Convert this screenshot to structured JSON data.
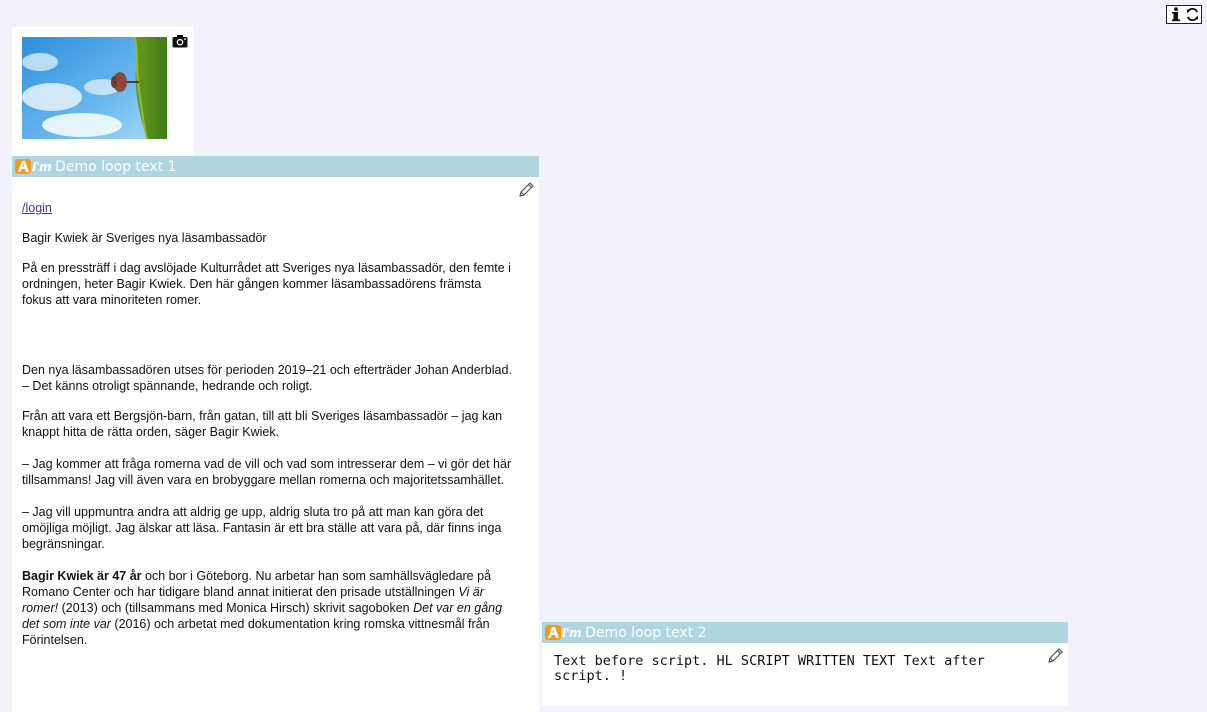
{
  "icons": {
    "info": "info-icon",
    "refresh": "refresh-icon",
    "camera": "camera-icon",
    "edit": "pencil-icon",
    "logo": "aim-logo-icon"
  },
  "colors": {
    "page_bg": "#f2f2fa",
    "panel_header": "#afd5e0",
    "link": "#5a2a8a",
    "logo_orange": "#f29a1a"
  },
  "logo": {
    "text": "I'm"
  },
  "panel1": {
    "title": "Demo loop text 1",
    "link": "/login",
    "headline": "Bagir Kwiek är Sveriges nya läsambassadör",
    "intro": "På en pressträff i dag avslöjade Kulturrådet att Sveriges nya läsambassadör, den femte i ordningen, heter Bagir Kwiek. Den här gången kommer läsambassadörens främsta fokus att vara minoriteten romer.",
    "para1_a": "Den nya läsambassadören utses för perioden 2019–21 och efterträder Johan Anderblad.",
    "para1_b": "– Det känns otroligt spännande, hedrande och roligt.",
    "para2": "Från att vara ett Bergsjön-barn, från gatan, till att bli Sveriges läsambassadör – jag kan knappt hitta de rätta orden, säger Bagir Kwiek.",
    "para3": "– Jag kommer att fråga romerna vad de vill och vad som intresserar dem – vi gör det här tillsammans! Jag vill även vara en brobyggare mellan romerna och majoritetssamhället.",
    "para4": "– Jag vill uppmuntra andra att aldrig ge upp, aldrig sluta tro på att man kan göra det omöjliga möjligt. Jag älskar att läsa. Fantasin är ett bra ställe att vara på, där finns inga begränsningar.",
    "para5_bold": "Bagir Kwiek är 47 år",
    "para5_text1": " och bor i Göteborg. Nu arbetar han som samhällsvägledare på Romano Center och har tidigare bland annat initierat den prisade utställningen ",
    "para5_italic1": "Vi är romer!",
    "para5_text2": " (2013) och (tillsammans med Monica Hirsch) skrivit sagoboken ",
    "para5_italic2": "Det var en gång det som inte var",
    "para5_text3": " (2016) och arbetat med dokumentation kring romska vittnesmål från Förintelsen."
  },
  "panel2": {
    "title": "Demo loop text 2",
    "body": "Text before script. HL SCRIPT WRITTEN TEXT Text after script. !"
  }
}
